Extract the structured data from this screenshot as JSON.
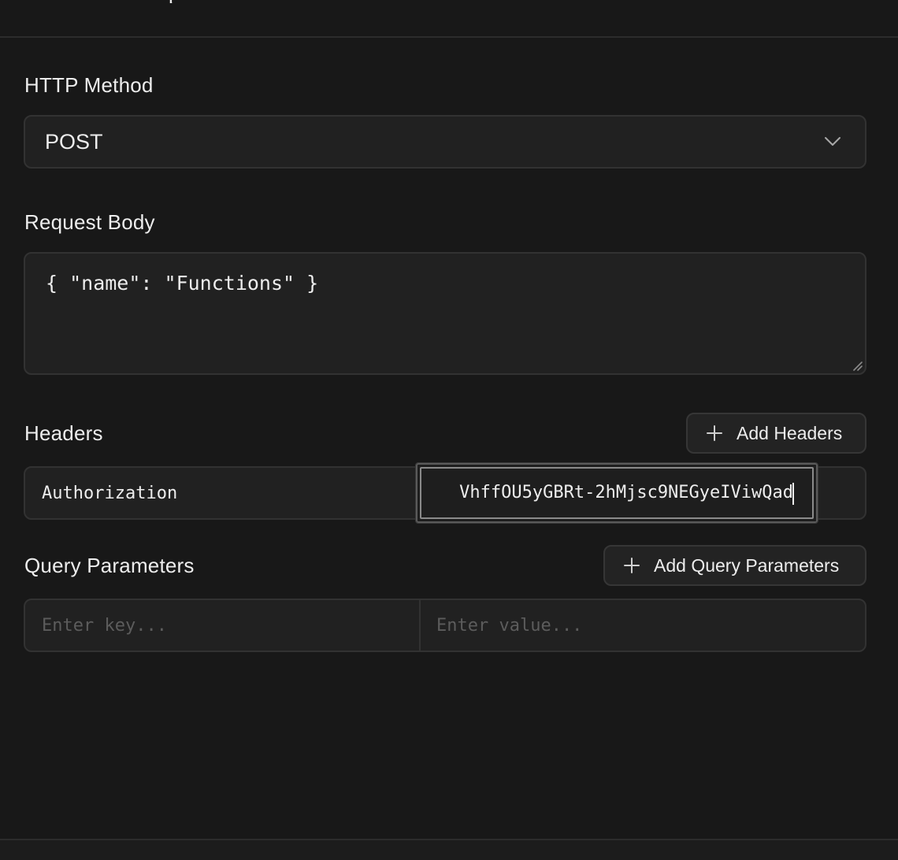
{
  "header": {
    "title_fragment": "p"
  },
  "method": {
    "label": "HTTP Method",
    "selected": "POST",
    "chevron_icon": "chevron-down-icon"
  },
  "body": {
    "label": "Request Body",
    "value": "{ \"name\": \"Functions\" }"
  },
  "headers": {
    "label": "Headers",
    "add_label": "Add Headers",
    "add_icon": "plus-icon",
    "rows": [
      {
        "key": "Authorization",
        "value": "VhffOU5yGBRt-2hMjsc9NEGyeIViwQad"
      }
    ]
  },
  "query": {
    "label": "Query Parameters",
    "add_label": "Add Query Parameters",
    "add_icon": "plus-icon",
    "key_placeholder": "Enter key...",
    "value_placeholder": "Enter value..."
  }
}
